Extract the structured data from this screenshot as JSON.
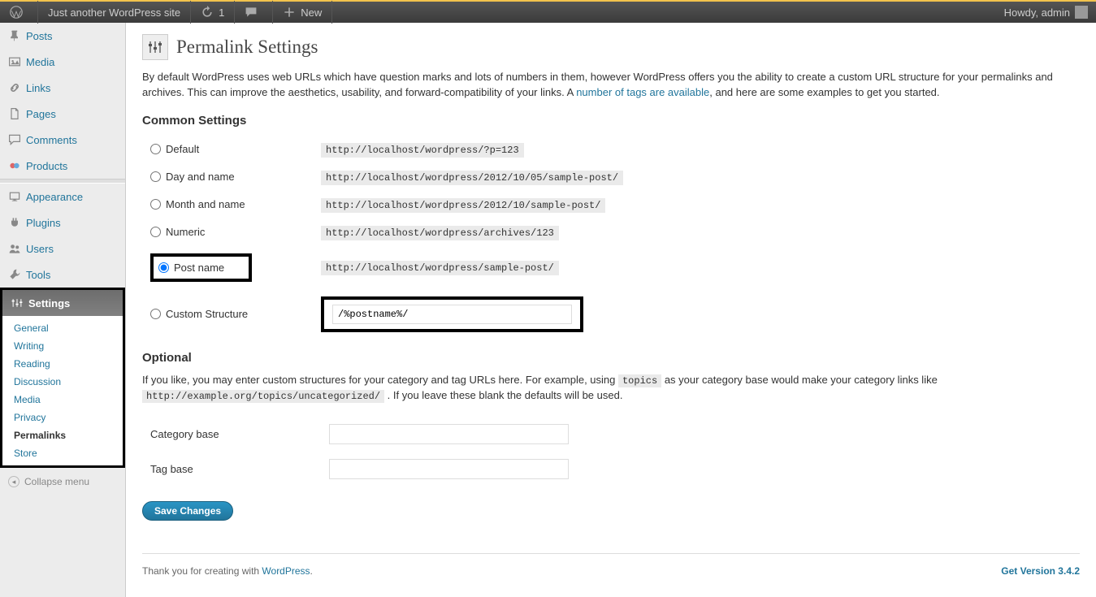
{
  "adminbar": {
    "site_title": "Just another WordPress site",
    "update_count": "1",
    "new_label": "New",
    "howdy": "Howdy, admin"
  },
  "sidebar": {
    "items": [
      {
        "label": "Posts",
        "icon": "pin"
      },
      {
        "label": "Media",
        "icon": "media"
      },
      {
        "label": "Links",
        "icon": "link"
      },
      {
        "label": "Pages",
        "icon": "page"
      },
      {
        "label": "Comments",
        "icon": "comment"
      },
      {
        "label": "Products",
        "icon": "product"
      }
    ],
    "items2": [
      {
        "label": "Appearance",
        "icon": "appearance"
      },
      {
        "label": "Plugins",
        "icon": "plugin"
      },
      {
        "label": "Users",
        "icon": "users"
      },
      {
        "label": "Tools",
        "icon": "tools"
      }
    ],
    "settings_label": "Settings",
    "submenu": [
      {
        "label": "General"
      },
      {
        "label": "Writing"
      },
      {
        "label": "Reading"
      },
      {
        "label": "Discussion"
      },
      {
        "label": "Media"
      },
      {
        "label": "Privacy"
      },
      {
        "label": "Permalinks",
        "active": true
      },
      {
        "label": "Store"
      }
    ],
    "collapse_label": "Collapse menu"
  },
  "page": {
    "title": "Permalink Settings",
    "intro_pre": "By default WordPress uses web URLs which have question marks and lots of numbers in them, however WordPress offers you the ability to create a custom URL structure for your permalinks and archives. This can improve the aesthetics, usability, and forward-compatibility of your links. A ",
    "intro_link": "number of tags are available",
    "intro_post": ", and here are some examples to get you started.",
    "common_heading": "Common Settings",
    "options": [
      {
        "label": "Default",
        "url": "http://localhost/wordpress/?p=123",
        "checked": false
      },
      {
        "label": "Day and name",
        "url": "http://localhost/wordpress/2012/10/05/sample-post/",
        "checked": false
      },
      {
        "label": "Month and name",
        "url": "http://localhost/wordpress/2012/10/sample-post/",
        "checked": false
      },
      {
        "label": "Numeric",
        "url": "http://localhost/wordpress/archives/123",
        "checked": false
      },
      {
        "label": "Post name",
        "url": "http://localhost/wordpress/sample-post/",
        "checked": true
      },
      {
        "label": "Custom Structure",
        "input": "/%postname%/",
        "checked": false
      }
    ],
    "optional_heading": "Optional",
    "optional_intro_a": "If you like, you may enter custom structures for your category and tag URLs here. For example, using ",
    "optional_code1": "topics",
    "optional_intro_b": " as your category base would make your category links like ",
    "optional_code2": "http://example.org/topics/uncategorized/",
    "optional_intro_c": " . If you leave these blank the defaults will be used.",
    "category_label": "Category base",
    "tag_label": "Tag base",
    "save_label": "Save Changes"
  },
  "footer": {
    "thank_pre": "Thank you for creating with ",
    "thank_link": "WordPress",
    "thank_post": ".",
    "version": "Get Version 3.4.2"
  }
}
